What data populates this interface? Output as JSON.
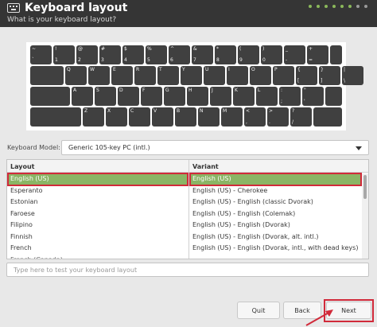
{
  "header": {
    "title": "Keyboard layout",
    "subtitle": "What is your keyboard layout?",
    "progress_steps_total": 8,
    "progress_steps_done": 6,
    "icon": "keyboard-icon"
  },
  "keyboard": {
    "rows": [
      [
        [
          "~",
          "`"
        ],
        [
          "!",
          "1"
        ],
        [
          "@",
          "2"
        ],
        [
          "#",
          "3"
        ],
        [
          "$",
          "4"
        ],
        [
          "%",
          "5"
        ],
        [
          "^",
          "6"
        ],
        [
          "&",
          "7"
        ],
        [
          "*",
          "8"
        ],
        [
          "(",
          "9"
        ],
        [
          ")",
          "0"
        ],
        [
          "_",
          "-"
        ],
        [
          "+",
          "="
        ]
      ],
      [
        [
          "Q",
          ""
        ],
        [
          "W",
          ""
        ],
        [
          "E",
          ""
        ],
        [
          "R",
          ""
        ],
        [
          "T",
          ""
        ],
        [
          "Y",
          ""
        ],
        [
          "U",
          ""
        ],
        [
          "I",
          ""
        ],
        [
          "O",
          ""
        ],
        [
          "P",
          ""
        ],
        [
          "{",
          "["
        ],
        [
          "}",
          "]"
        ],
        [
          "|",
          "\\"
        ]
      ],
      [
        [
          "A",
          ""
        ],
        [
          "S",
          ""
        ],
        [
          "D",
          ""
        ],
        [
          "F",
          ""
        ],
        [
          "G",
          ""
        ],
        [
          "H",
          ""
        ],
        [
          "J",
          ""
        ],
        [
          "K",
          ""
        ],
        [
          "L",
          ""
        ],
        [
          ":",
          ";"
        ],
        [
          "\"",
          "'"
        ]
      ],
      [
        [
          "Z",
          ""
        ],
        [
          "X",
          ""
        ],
        [
          "C",
          ""
        ],
        [
          "V",
          ""
        ],
        [
          "B",
          ""
        ],
        [
          "N",
          ""
        ],
        [
          "M",
          ""
        ],
        [
          "<",
          ","
        ],
        [
          ">",
          "."
        ],
        [
          "?",
          "/"
        ]
      ]
    ]
  },
  "model": {
    "label": "Keyboard Model:",
    "value": "Generic 105-key PC (intl.)"
  },
  "layout_table": {
    "header": "Layout",
    "selected_index": 0,
    "items": [
      "English (US)",
      "Esperanto",
      "Estonian",
      "Faroese",
      "Filipino",
      "Finnish",
      "French",
      "French (Canada)"
    ]
  },
  "variant_table": {
    "header": "Variant",
    "selected_index": 0,
    "items": [
      "English (US)",
      "English (US) - Cherokee",
      "English (US) - English (classic Dvorak)",
      "English (US) - English (Colemak)",
      "English (US) - English (Dvorak)",
      "English (US) - English (Dvorak, alt. intl.)",
      "English (US) - English (Dvorak, intl., with dead keys)"
    ]
  },
  "test_input": {
    "placeholder": "Type here to test your keyboard layout",
    "value": ""
  },
  "buttons": {
    "quit": "Quit",
    "back": "Back",
    "next": "Next"
  },
  "colors": {
    "header_bg": "#353535",
    "selection": "#8ab565",
    "annotation": "#d12a3a",
    "key": "#404040"
  }
}
